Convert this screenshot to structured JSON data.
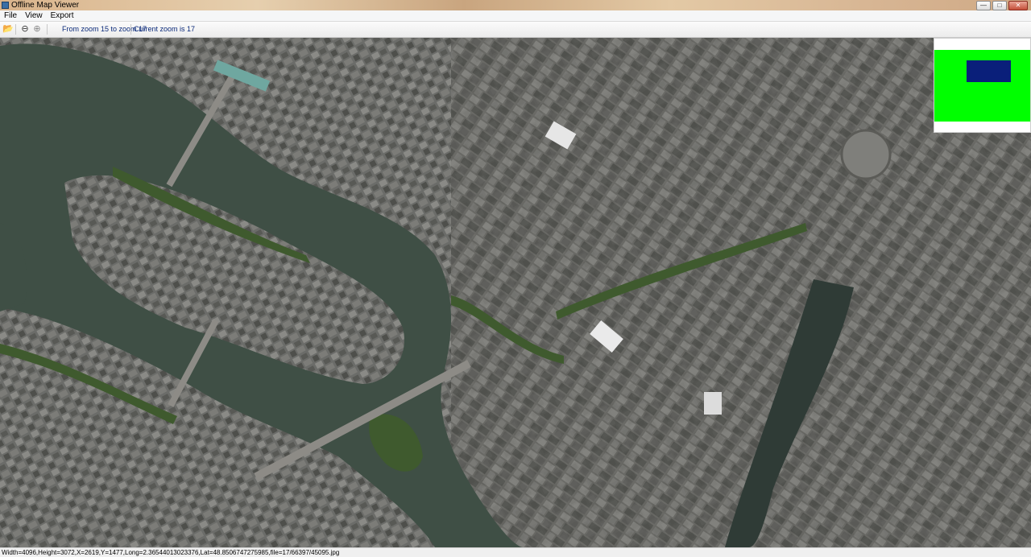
{
  "window": {
    "title": "Offline Map Viewer",
    "controls": [
      "minimize-icon",
      "maximize-icon",
      "close-icon"
    ]
  },
  "menu": {
    "items": [
      "File",
      "View",
      "Export"
    ]
  },
  "toolbar": {
    "icons": [
      "open-folder-icon",
      "zoom-out-icon",
      "zoom-in-icon"
    ],
    "zoom_range_label": "From zoom 15 to zoom 17",
    "current_zoom_label": "Current zoom is 17"
  },
  "map": {
    "type": "satellite imagery",
    "colors": {
      "river": "#3f4f45",
      "city": "#6d6e6c",
      "trees": "#3f5a2e"
    }
  },
  "minimap": {
    "colors": {
      "background": "#ffffff",
      "extent": "#00ff00",
      "viewport": "#0a1f7a"
    }
  },
  "status": {
    "text": "Width=4096,Height=3072,X=2619,Y=1477,Long=2.36544013023376,Lat=48.8506747275985,file=17/66397/45095.jpg"
  }
}
